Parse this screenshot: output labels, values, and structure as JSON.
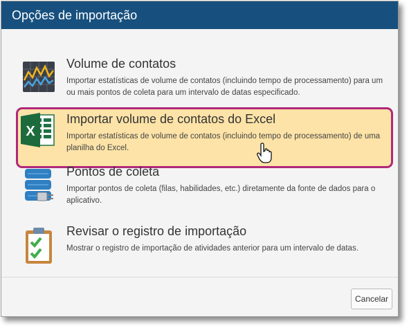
{
  "dialog": {
    "title": "Opções de importação",
    "options": [
      {
        "title": "Volume de contatos",
        "description": "Importar estatísticas de volume de contatos (incluindo tempo de processamento) para um ou mais pontos de coleta para um intervalo de datas especificado.",
        "icon": "chart-icon"
      },
      {
        "title": "Importar volume de contatos do Excel",
        "description": "Importar estatísticas de volume de contatos (incluindo tempo de processamento) de uma planilha do Excel.",
        "icon": "excel-icon",
        "highlighted": true
      },
      {
        "title": "Pontos de coleta",
        "description": "Importar pontos de coleta (filas, habilidades, etc.) diretamente da fonte de dados para o aplicativo.",
        "icon": "database-plug-icon"
      },
      {
        "title": "Revisar o registro de importação",
        "description": "Mostrar o registro de importação de atividades anterior para um intervalo de datas.",
        "icon": "clipboard-check-icon"
      }
    ],
    "cancel_label": "Cancelar"
  },
  "colors": {
    "titlebar": "#17507e",
    "highlight_fill": "#fde3a7",
    "highlight_border": "#b0287a"
  }
}
